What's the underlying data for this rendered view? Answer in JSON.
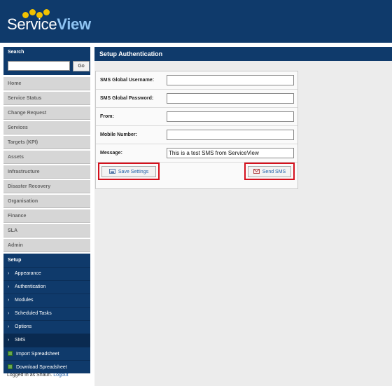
{
  "brand": {
    "logo_main": "Service",
    "logo_accent": "View"
  },
  "search": {
    "title": "Search",
    "input_value": "",
    "go_label": "Go"
  },
  "nav": {
    "items": [
      {
        "label": "Home"
      },
      {
        "label": "Service Status"
      },
      {
        "label": "Change Request"
      },
      {
        "label": "Services"
      },
      {
        "label": "Targets (KPI)"
      },
      {
        "label": "Assets"
      },
      {
        "label": "Infrastructure"
      },
      {
        "label": "Disaster Recovery"
      },
      {
        "label": "Organisation"
      },
      {
        "label": "Finance"
      },
      {
        "label": "SLA"
      },
      {
        "label": "Admin"
      }
    ],
    "setup_title": "Setup",
    "setup_items": [
      {
        "label": "Appearance"
      },
      {
        "label": "Authentication"
      },
      {
        "label": "Modules"
      },
      {
        "label": "Scheduled Tasks"
      },
      {
        "label": "Options"
      },
      {
        "label": "SMS"
      }
    ],
    "import_label": "Import Spreadsheet",
    "download_label": "Download Spreadsheet",
    "chevron": "›"
  },
  "session": {
    "logged_in_text": "Logged in as Shaun.",
    "logout_label": "Logout"
  },
  "content": {
    "title": "Setup Authentication",
    "fields": [
      {
        "label": "SMS Global Username:",
        "value": ""
      },
      {
        "label": "SMS Global Password:",
        "value": ""
      },
      {
        "label": "From:",
        "value": ""
      },
      {
        "label": "Mobile Number:",
        "value": ""
      },
      {
        "label": "Message:",
        "value": "This is a test SMS from ServiceView"
      }
    ],
    "save_label": "Save Settings",
    "send_label": "Send SMS"
  },
  "colors": {
    "header_blue": "#0f3a6b",
    "highlight_red": "#d4101c",
    "logo_dots": "#f2c200"
  }
}
